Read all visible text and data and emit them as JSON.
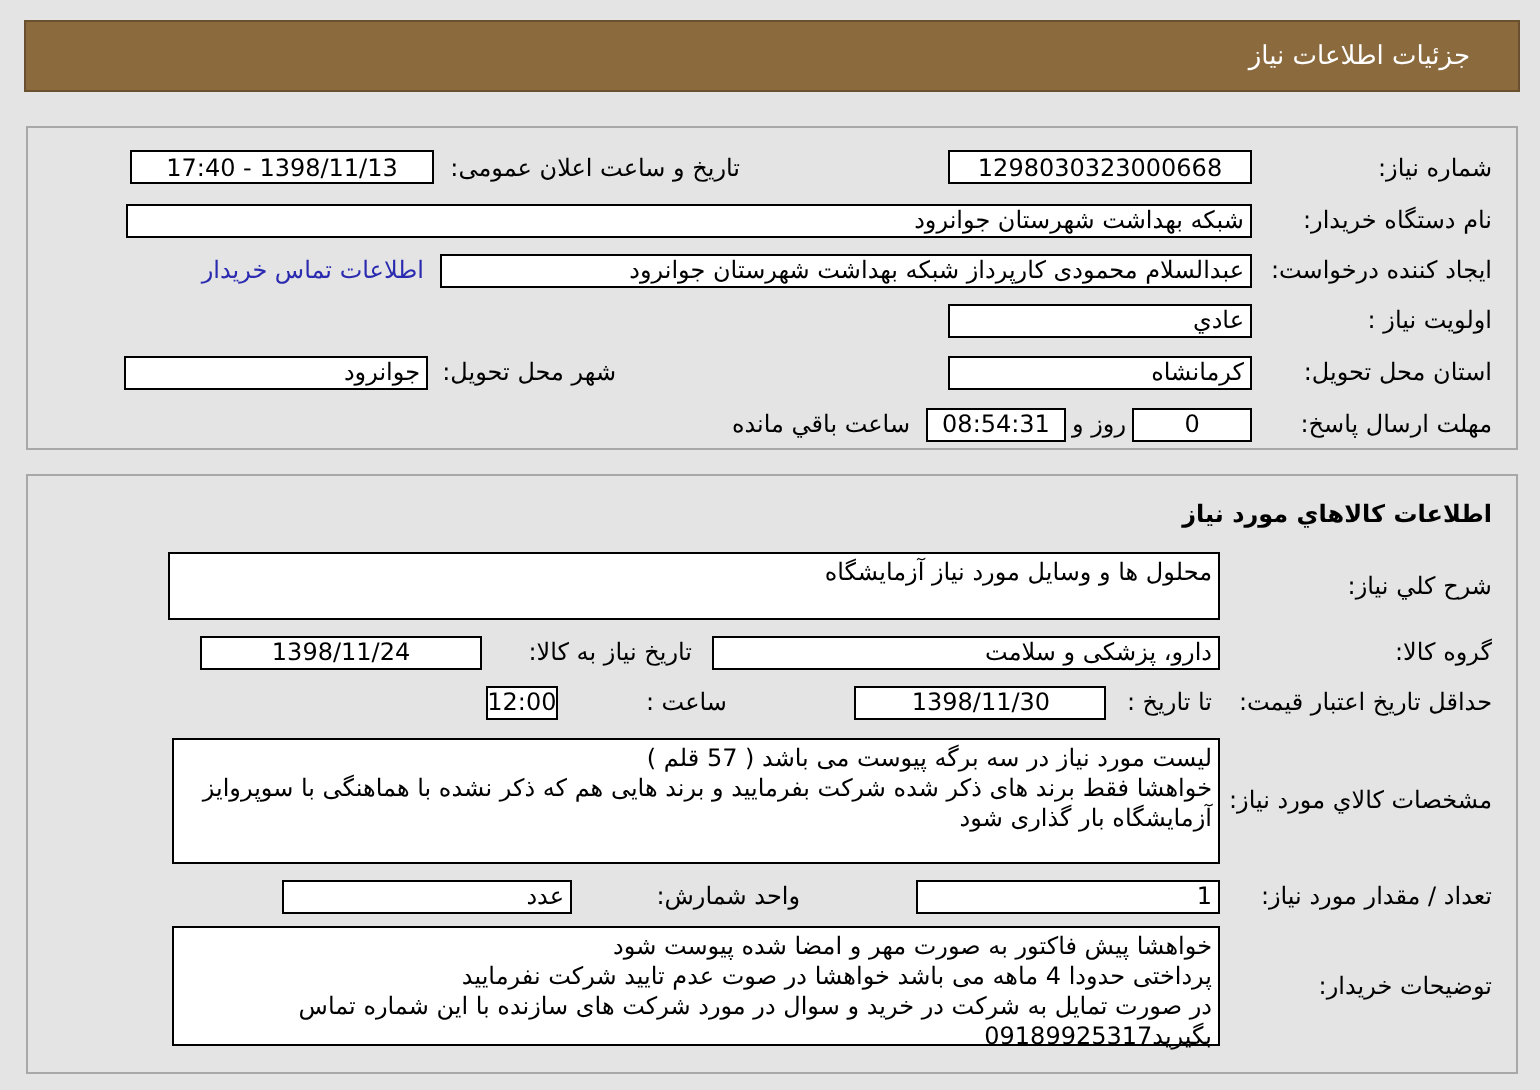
{
  "header": {
    "title": "جزئیات اطلاعات نیاز"
  },
  "need_info": {
    "need_number": {
      "label": "شماره نیاز:",
      "value": "1298030323000668"
    },
    "announce_date": {
      "label": "تاریخ و ساعت اعلان عمومی:",
      "value": "1398/11/13 - 17:40"
    },
    "buyer_org": {
      "label": "نام دستگاه خریدار:",
      "value": "شبکه بهداشت شهرستان جوانرود"
    },
    "requester": {
      "label": "ایجاد کننده درخواست:",
      "value": "عبدالسلام محمودی کارپرداز شبکه بهداشت شهرستان جوانرود"
    },
    "contact_link": "اطلاعات تماس خریدار",
    "priority": {
      "label": "اولویت نیاز :",
      "value": "عادي"
    },
    "province": {
      "label": "استان محل تحویل:",
      "value": "کرمانشاه"
    },
    "city": {
      "label": "شهر محل تحویل:",
      "value": "جوانرود"
    },
    "deadline": {
      "label": "مهلت ارسال پاسخ:",
      "days": "0",
      "days_unit": "روز و",
      "time": "08:54:31",
      "remaining": "ساعت باقي مانده"
    }
  },
  "goods_info": {
    "title": "اطلاعات کالاهاي مورد نياز",
    "description": {
      "label": "شرح کلي نياز:",
      "value": "محلول ها و وسایل مورد نیاز آزمایشگاه"
    },
    "group": {
      "label": "گروه کالا:",
      "value": "دارو، پزشکی و سلامت"
    },
    "need_date": {
      "label": "تاریخ نیاز به کالا:",
      "value": "1398/11/24"
    },
    "price_validity": {
      "label": "حداقل تاریخ اعتبار قیمت:",
      "to_date_label": "تا تاریخ :",
      "date": "1398/11/30",
      "time_label": "ساعت :",
      "time": "12:00"
    },
    "specs": {
      "label": "مشخصات کالاي مورد نياز:",
      "lines": [
        "لیست مورد نیاز در سه برگه پیوست می باشد ( 57 قلم )",
        "خواهشا فقط برند های ذکر شده شرکت بفرمایید و برند هایی هم که ذکر نشده با هماهنگی با سوپروایز آزمایشگاه بار گذاری شود"
      ]
    },
    "quantity": {
      "label": "تعداد / مقدار مورد نیاز:",
      "value": "1"
    },
    "unit": {
      "label": "واحد شمارش:",
      "value": "عدد"
    },
    "notes": {
      "label": "توضیحات خریدار:",
      "lines": [
        "خواهشا پیش فاکتور به صورت مهر و امضا شده پیوست شود",
        "پرداختی حدودا 4 ماهه می باشد خواهشا در صوت عدم تایید شرکت نفرمایید",
        "در صورت تمایل به  شرکت در خرید و سوال در مورد شرکت های سازنده با این شماره تماس بگیرید09189925317"
      ]
    }
  }
}
